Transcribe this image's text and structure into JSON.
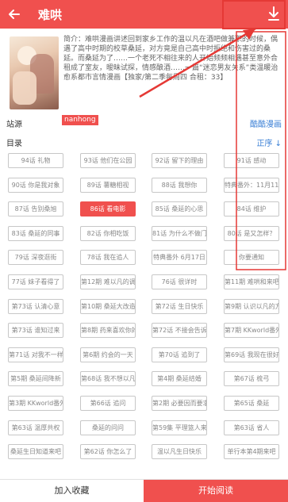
{
  "appbar": {
    "title": "难哄"
  },
  "book": {
    "author": "nanhong",
    "description": "简介：难哄漫画讲述回到家乡工作的温以凡在酒吧做兼职的时候，偶遇了高中时期的校草桑延，对方竟是自己高中时拒绝和伤害过的桑延。而桑延为了……一个老死不相往来的人开始频频相遇甚至意外合租成了室友，暧昧试探，情感酿酒……一篇“迷恋男友关系”类温暖治愈系都市言情漫画【独家/第二季每周四 合租：33】"
  },
  "source": {
    "label": "站源",
    "value": "酷酷漫画"
  },
  "toc": {
    "label": "目录",
    "order": "正序 ↓"
  },
  "chapters": [
    "94话 礼物",
    "93话 他们在公园",
    "92话 留下的理由",
    "91话 感动",
    "90话 你是我对象",
    "89话 薯糖相视",
    "88话 我想你",
    "特典番外：11月11日",
    "87话 告别桑旭",
    "86话 看电影",
    "85话 桑延的心思",
    "84话 维护",
    "83话 桑延的同事",
    "82话 你相吃饭",
    "81话 为什么不做门的",
    "80话 是又怎样？",
    "79话 深夜逛街",
    "78话 我在追人",
    "特典番外 6月17日",
    "你要通知",
    "77话 妹子看得了",
    "第12期 难以凡的调查",
    "76话 很详时",
    "第11期 难哄和来吧",
    "第73话 认清心意",
    "第10期 桑延大改造",
    "第72话 生日快乐",
    "第9期 认识以凡的方式",
    "第73话 谁知过来",
    "第8期 药来喜欢你的呀",
    "第72话 不接会告诉",
    "第7期 KKworld番外",
    "第71话 对我不一样",
    "第6期 约会的一天",
    "第70话 追到了",
    "第69话 我现在很好",
    "第5期 桑延间降新",
    "第68话 我不想以凡生",
    "第4期 桑延结婚",
    "第67话 梳弓",
    "第3期 KKworld番外",
    "第66话 追问",
    "第2期 必要因而要求",
    "第65话 桑延",
    "第63话 温厚共权",
    "桑延的问问",
    "第59集 平理篮人来看",
    "第63话 省人",
    "桑延生日知道来吧",
    "第62话 你怎么了",
    "温以凡生日快乐",
    "单行本第4期来吧"
  ],
  "active_chapter": "86话 看电影",
  "bottom": {
    "favorite": "加入收藏",
    "read": "开始阅读"
  }
}
